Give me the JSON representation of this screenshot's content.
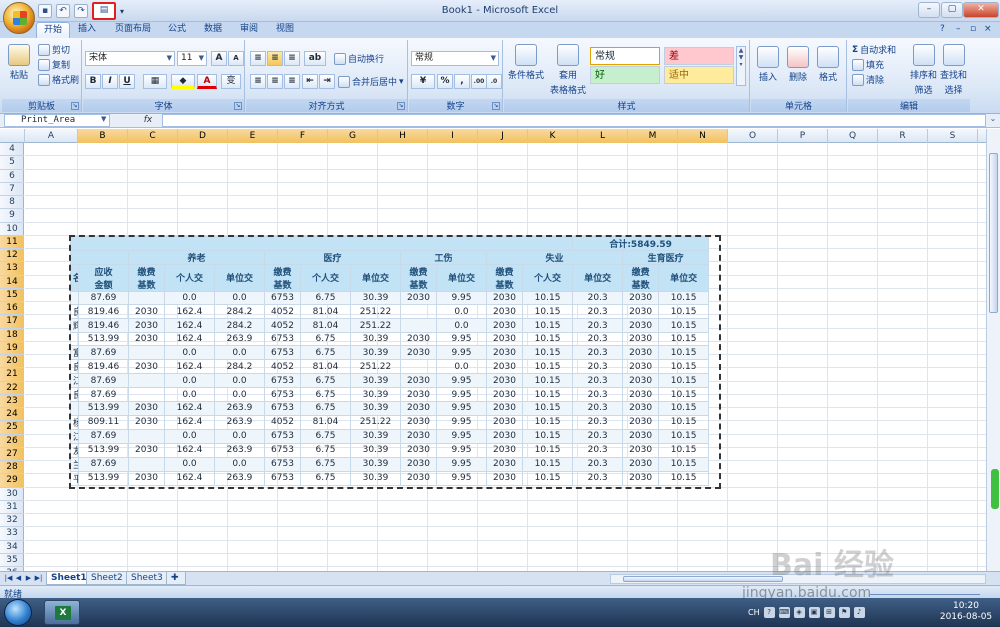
{
  "window": {
    "title": "Book1 - Microsoft Excel"
  },
  "tabs": [
    "开始",
    "插入",
    "页面布局",
    "公式",
    "数据",
    "审阅",
    "视图"
  ],
  "ribbon": {
    "clipboard": {
      "paste": "粘贴",
      "cut": "剪切",
      "copy": "复制",
      "format_painter": "格式刷",
      "label": "剪贴板"
    },
    "font": {
      "name": "宋体",
      "size": "11",
      "bold": "B",
      "italic": "I",
      "underline": "U",
      "grow": "A",
      "font_color": "A",
      "phonetic": "变",
      "label": "字体"
    },
    "alignment": {
      "wrap": "自动换行",
      "merge": "合并后居中",
      "label": "对齐方式"
    },
    "number": {
      "format": "常规",
      "percent": "%",
      "comma": ",",
      "label": "数字"
    },
    "styles": {
      "conditional": "条件格式",
      "table": "套用",
      "table2": "表格格式",
      "normal": "常规",
      "bad": "差",
      "good": "好",
      "neutral": "适中",
      "label": "样式"
    },
    "cells": {
      "insert": "插入",
      "delete": "删除",
      "format": "格式",
      "label": "单元格"
    },
    "editing": {
      "autosum": "自动求和",
      "fill": "填充",
      "clear": "清除",
      "sort": "排序和",
      "sort2": "筛选",
      "find": "查找和",
      "find2": "选择",
      "label": "编辑"
    }
  },
  "formula_bar": {
    "name_box": "Print_Area",
    "fx": "fx"
  },
  "columns": [
    "A",
    "B",
    "C",
    "D",
    "E",
    "F",
    "G",
    "H",
    "I",
    "J",
    "K",
    "L",
    "M",
    "N",
    "O",
    "P",
    "Q",
    "R",
    "S"
  ],
  "rows": [
    "4",
    "5",
    "6",
    "7",
    "8",
    "9",
    "10",
    "11",
    "12",
    "13",
    "14",
    "15",
    "16",
    "17",
    "18",
    "19",
    "20",
    "21",
    "22",
    "23",
    "24",
    "25",
    "26",
    "27",
    "28",
    "29",
    "30",
    "31",
    "32",
    "33",
    "34",
    "35",
    "36",
    "37"
  ],
  "sheet": {
    "total": "合计:5849.59",
    "groups": [
      "养老",
      "医疗",
      "工伤",
      "失业",
      "生育医疗"
    ],
    "col_headers": [
      "名",
      "应收\n金额",
      "缴费\n基数",
      "个人交",
      "单位交",
      "缴费\n基数",
      "个人交",
      "单位交",
      "缴费\n基数",
      "单位交",
      "缴费\n基数",
      "个人交",
      "单位交",
      "缴费\n基数",
      "单位交"
    ],
    "data": [
      [
        "",
        "87.69",
        "",
        "0.0",
        "0.0",
        "6753",
        "6.75",
        "30.39",
        "2030",
        "9.95",
        "2030",
        "10.15",
        "20.3",
        "2030",
        "10.15"
      ],
      [
        "良",
        "819.46",
        "2030",
        "162.4",
        "284.2",
        "4052",
        "81.04",
        "251.22",
        "",
        "0.0",
        "2030",
        "10.15",
        "20.3",
        "2030",
        "10.15"
      ],
      [
        "辉",
        "819.46",
        "2030",
        "162.4",
        "284.2",
        "4052",
        "81.04",
        "251.22",
        "",
        "0.0",
        "2030",
        "10.15",
        "20.3",
        "2030",
        "10.15"
      ],
      [
        "",
        "513.99",
        "2030",
        "162.4",
        "263.9",
        "6753",
        "6.75",
        "30.39",
        "2030",
        "9.95",
        "2030",
        "10.15",
        "20.3",
        "2030",
        "10.15"
      ],
      [
        "富",
        "87.69",
        "",
        "0.0",
        "0.0",
        "6753",
        "6.75",
        "30.39",
        "2030",
        "9.95",
        "2030",
        "10.15",
        "20.3",
        "2030",
        "10.15"
      ],
      [
        "良",
        "819.46",
        "2030",
        "162.4",
        "284.2",
        "4052",
        "81.04",
        "251.22",
        "",
        "0.0",
        "2030",
        "10.15",
        "20.3",
        "2030",
        "10.15"
      ],
      [
        "江",
        "87.69",
        "",
        "0.0",
        "0.0",
        "6753",
        "6.75",
        "30.39",
        "2030",
        "9.95",
        "2030",
        "10.15",
        "20.3",
        "2030",
        "10.15"
      ],
      [
        "良",
        "87.69",
        "",
        "0.0",
        "0.0",
        "6753",
        "6.75",
        "30.39",
        "2030",
        "9.95",
        "2030",
        "10.15",
        "20.3",
        "2030",
        "10.15"
      ],
      [
        "",
        "513.99",
        "2030",
        "162.4",
        "263.9",
        "6753",
        "6.75",
        "30.39",
        "2030",
        "9.95",
        "2030",
        "10.15",
        "20.3",
        "2030",
        "10.15"
      ],
      [
        "杨",
        "809.11",
        "2030",
        "162.4",
        "263.9",
        "4052",
        "81.04",
        "251.22",
        "2030",
        "9.95",
        "2030",
        "10.15",
        "20.3",
        "2030",
        "10.15"
      ],
      [
        "江",
        "87.69",
        "",
        "0.0",
        "0.0",
        "6753",
        "6.75",
        "30.39",
        "2030",
        "9.95",
        "2030",
        "10.15",
        "20.3",
        "2030",
        "10.15"
      ],
      [
        "友",
        "513.99",
        "2030",
        "162.4",
        "263.9",
        "6753",
        "6.75",
        "30.39",
        "2030",
        "9.95",
        "2030",
        "10.15",
        "20.3",
        "2030",
        "10.15"
      ],
      [
        "兰",
        "87.69",
        "",
        "0.0",
        "0.0",
        "6753",
        "6.75",
        "30.39",
        "2030",
        "9.95",
        "2030",
        "10.15",
        "20.3",
        "2030",
        "10.15"
      ],
      [
        "平",
        "513.99",
        "2030",
        "162.4",
        "263.9",
        "6753",
        "6.75",
        "30.39",
        "2030",
        "9.95",
        "2030",
        "10.15",
        "20.3",
        "2030",
        "10.15"
      ]
    ]
  },
  "sheet_tabs": [
    "Sheet1",
    "Sheet2",
    "Sheet3"
  ],
  "status": {
    "text": "就绪"
  },
  "taskbar": {
    "lang": "CH",
    "time": "10:20",
    "date": "2016-08-05"
  },
  "watermark": {
    "brand": "Bai 经验",
    "url": "jingyan.baidu.com"
  },
  "colors": {
    "accent": "#15428b",
    "table_header": "#c2e3f5",
    "selected_header": "#f1c15f",
    "bad_fill": "#ffc7ce",
    "good_fill": "#c6efce",
    "neutral_fill": "#ffeb9c"
  }
}
